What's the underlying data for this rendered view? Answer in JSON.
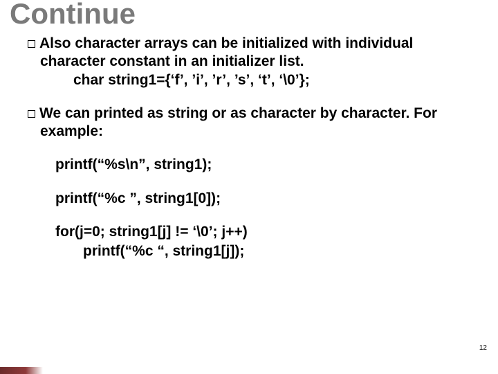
{
  "title": "Continue",
  "paragraphs": {
    "p1_lead": "Also ",
    "p1_rest": "character arrays can be initialized with individual character constant in an initializer list.",
    "p1_code": "char  string1={‘f’, ’i’, ’r’, ’s’, ‘t’, ‘\\0’};",
    "p2_lead": "We ",
    "p2_rest": "can printed as string or as character by character. For example:"
  },
  "code": {
    "l1": "printf(“%s\\n”, string1);",
    "l2": "printf(“%c  ”, string1[0]);",
    "l3": "for(j=0; string1[j] != ‘\\0’; j++)",
    "l4": "printf(“%c “, string1[j]);"
  },
  "pagenum": "12"
}
